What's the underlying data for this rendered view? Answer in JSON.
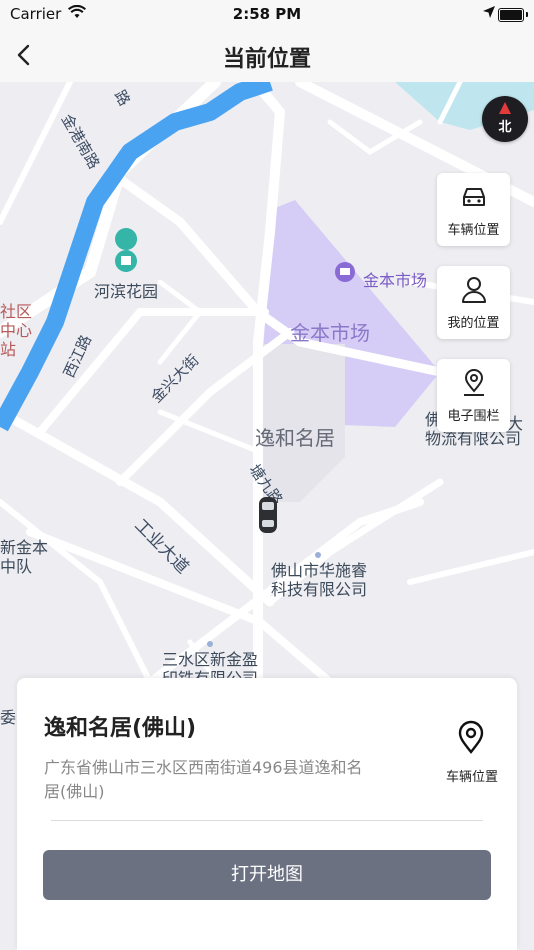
{
  "status_bar": {
    "carrier": "Carrier",
    "time": "2:58 PM"
  },
  "nav": {
    "title": "当前位置"
  },
  "map": {
    "compass_label": "北",
    "labels": {
      "jinben_market_poi": "金本市场",
      "jinben_market_area": "金本市场",
      "yihe_mingju": "逸和名居",
      "hebin_garden": "河滨花园",
      "jinxing_street": "金兴大街",
      "tangjiu_road": "塘九路",
      "industry_road": "工业大道",
      "huashirui": "佛山市华施睿\n科技有限公司",
      "sanshui_xinjinying": "三水区新金盈\n印铁有限公司",
      "logistics": "佛\n物流有限公司",
      "logistics_suffix": "大",
      "community_center": "社区\n中心\n站",
      "xinjinben": "新金本\n中队",
      "jingang_road": "金港南路",
      "xijiang_road": "西江路",
      "committee": "委会",
      "road_top": "路"
    },
    "colors": {
      "river": "#4aa3f0",
      "market_area": "#d6cdf6",
      "road": "#ffffff",
      "background": "#eeeef2"
    }
  },
  "side_buttons": [
    {
      "label": "车辆位置",
      "icon": "car-icon"
    },
    {
      "label": "我的位置",
      "icon": "user-icon"
    },
    {
      "label": "电子围栏",
      "icon": "geofence-icon"
    }
  ],
  "card": {
    "place_name": "逸和名居(佛山)",
    "address": "广东省佛山市三水区西南街道496县道逸和名居(佛山)",
    "vehicle_location_label": "车辆位置",
    "open_map_label": "打开地图"
  }
}
